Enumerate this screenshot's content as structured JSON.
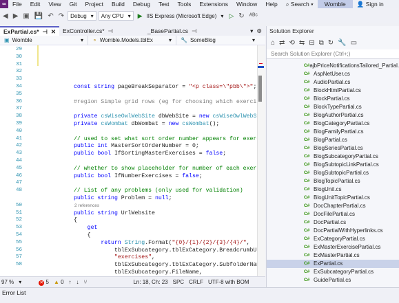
{
  "menu": {
    "items": [
      "File",
      "Edit",
      "View",
      "Git",
      "Project",
      "Build",
      "Debug",
      "Test",
      "Tools",
      "Extensions",
      "Window",
      "Help"
    ],
    "search": "Search",
    "solution": "Womble",
    "signin": "Sign in"
  },
  "toolbar": {
    "config": "Debug",
    "platform": "Any CPU",
    "run_target": "IIS Express (Microsoft Edge)"
  },
  "tabs": [
    {
      "label": "ExPartial.cs*"
    },
    {
      "label": "ExController.cs*"
    },
    {
      "label": "_BasePartial.cs"
    }
  ],
  "nav": {
    "project": "Womble",
    "type": "Womble.Models.tblEx",
    "member": "SomeBlog"
  },
  "editor": {
    "line_numbers": [
      "29",
      "30",
      "31",
      "32",
      "33",
      "34",
      "35",
      "36",
      "37",
      "38",
      "39",
      "40",
      "41",
      "42",
      "43",
      "44",
      "45",
      "46",
      "47",
      "48",
      "",
      "50",
      "51",
      "52",
      "53",
      "54",
      "55",
      "56",
      "57",
      "58"
    ],
    "code_lines": [
      "",
      "",
      "",
      "",
      "",
      "const string pageBreakSeparator = \"<p class=\\\"pbb\\\">\";",
      "",
      "#region Simple grid rows (eg for choosing which exercise",
      "",
      "private csWiseOwlWebSite dbWebSite = new csWiseOwlWebSite",
      "private csWombat dbWombat = new csWombat();",
      "",
      "// used to set what sort order number appears for exercis",
      "public int MasterSortOrderNumber = 0;",
      "public bool IfSortingMasterExercises = false;",
      "",
      "// whether to show placeholder for number of each exercis",
      "public bool IfNumberExercises = false;",
      "",
      "// List of any problems (only used for validation)",
      "public string Problem = null;",
      "public string UrlWebsite",
      "{",
      "    get",
      "    {",
      "        return String.Format(\"{0}/{1}/{2}/{3}/{4}/\",",
      "            tblExSubcategory.tblExCategory.BreadcrumbUnit",
      "            \"exercises\",",
      "            tblExSubcategory.tblExCategory.SubfolderName,",
      "            tblExSubcategory.FileName,",
      "            ExId.ToString());"
    ],
    "ref_hint": "2 references"
  },
  "status": {
    "zoom": "97 %",
    "errors": "5",
    "warnings": "0",
    "position": "Ln: 18, Ch: 23",
    "spc": "SPC",
    "crlf": "CRLF",
    "encoding": "UTF-8 with BOM"
  },
  "bottom": {
    "tab": "Error List"
  },
  "solution_explorer": {
    "title": "Solution Explorer",
    "search_placeholder": "Search Solution Explorer (Ctrl+;)",
    "files": [
      "ajbPriceNotificationsTailored_Partial.cs",
      "AspNetUser.cs",
      "AudioPartial.cs",
      "BlockHtmlPartial.cs",
      "BlockPartial.cs",
      "BlockTypePartial.cs",
      "BlogAuthorPartial.cs",
      "BlogCategoryPartial.cs",
      "BlogFamilyPartial.cs",
      "BlogPartial.cs",
      "BlogSeriesPartial.cs",
      "BlogSubcategoryPartial.cs",
      "BlogSubtopicLinkPartial.cs",
      "BlogSubtopicPartial.cs",
      "BlogTopicPartial.cs",
      "BlogUnit.cs",
      "BlogUnitTopicPartial.cs",
      "DocChapterPartial.cs",
      "DocFilePartial.cs",
      "DocPartial.cs",
      "DocPartialWithHyperlinks.cs",
      "ExCategoryPartial.cs",
      "ExMasterExercisePartial.cs",
      "ExMasterPartial.cs",
      "ExPartial.cs",
      "ExSubcategoryPartial.cs",
      "GuidePartial.cs"
    ],
    "selected": "ExPartial.cs",
    "file_badge": "C#"
  }
}
